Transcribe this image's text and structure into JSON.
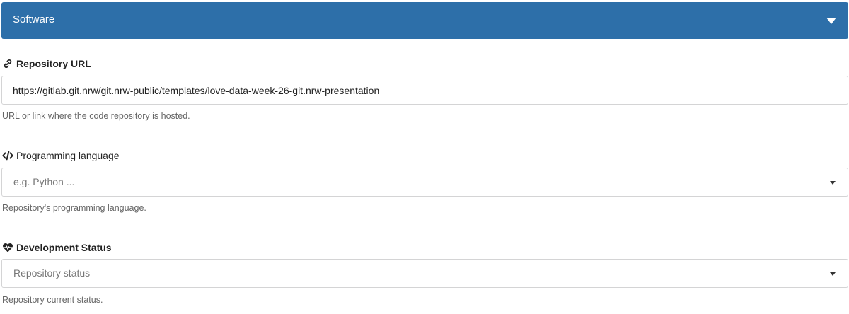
{
  "accordion": {
    "title": "Software"
  },
  "fields": {
    "repository_url": {
      "label": "Repository URL",
      "icon": "link-icon",
      "value": "https://gitlab.git.nrw/git.nrw-public/templates/love-data-week-26-git.nrw-presentation",
      "help": "URL or link where the code repository is hosted."
    },
    "programming_language": {
      "label": "Programming language",
      "icon": "code-icon",
      "placeholder": "e.g. Python ...",
      "help": "Repository's programming language."
    },
    "development_status": {
      "label": "Development Status",
      "icon": "heartbeat-icon",
      "placeholder": "Repository status",
      "help": "Repository current status."
    }
  },
  "colors": {
    "accent": "#2d6fa9",
    "border": "#d4d4d5",
    "help_text": "#666666"
  }
}
